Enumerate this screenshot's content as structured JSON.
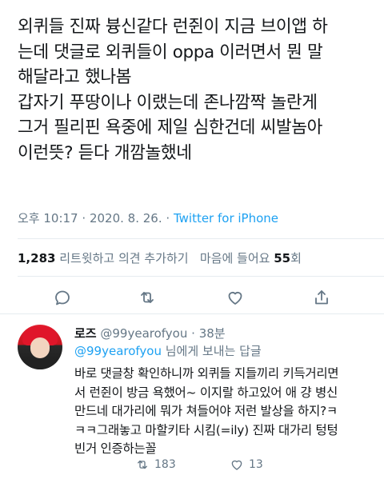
{
  "tweet": {
    "lines": [
      "외퀴들 진짜 븅신같다 런쥔이 지금 브이앱 하",
      "는데 댓글로 외퀴들이 oppa 이러면서 뭔 말",
      "해달라고 했나봄",
      "갑자기 푸땅이나 이랬는데 존나깜짝 놀란게",
      "그거 필리핀 욕중에 제일 심한건데 씨발놈아",
      "이런뜻? 듣다 개깜놀했네"
    ],
    "time": "오후 10:17",
    "date": "2020. 8. 26.",
    "separator": "·",
    "source": "Twitter for iPhone"
  },
  "stats": {
    "retweet_count": "1,283",
    "retweet_label": "리트윗하고 의견 추가하기",
    "like_label": "마음에 들어요",
    "like_count": "55",
    "like_unit": "회"
  },
  "actions": {
    "reply_icon": "comment-icon",
    "retweet_icon": "retweet-icon",
    "like_icon": "heart-icon",
    "share_icon": "share-icon"
  },
  "reply": {
    "name": "로즈",
    "handle": "@99yearofyou",
    "separator": "·",
    "time": "38분",
    "to_mention": "@99yearofyou",
    "to_suffix": " 님에게 보내는 답글",
    "lines": [
      "바로 댓글창 확인하니까 외퀴들 지들끼리 키득거리면",
      "서 런쥔이 방금 욕했어~ 이지랄 하고있어 애 걍 병신",
      "만드네 대가리에 뭐가 쳐들어야 저런 발상을 하지?ㅋ",
      "ㅋㅋ그래놓고 마할키타 시킴(=ily) 진짜 대가리 텅텅",
      "빈거 인증하는꼴"
    ],
    "retweet_count": "183",
    "like_count": "13"
  },
  "colors": {
    "text": "#14171a",
    "secondary": "#657786",
    "accent": "#1da1f2",
    "divider": "#e6ecf0"
  }
}
